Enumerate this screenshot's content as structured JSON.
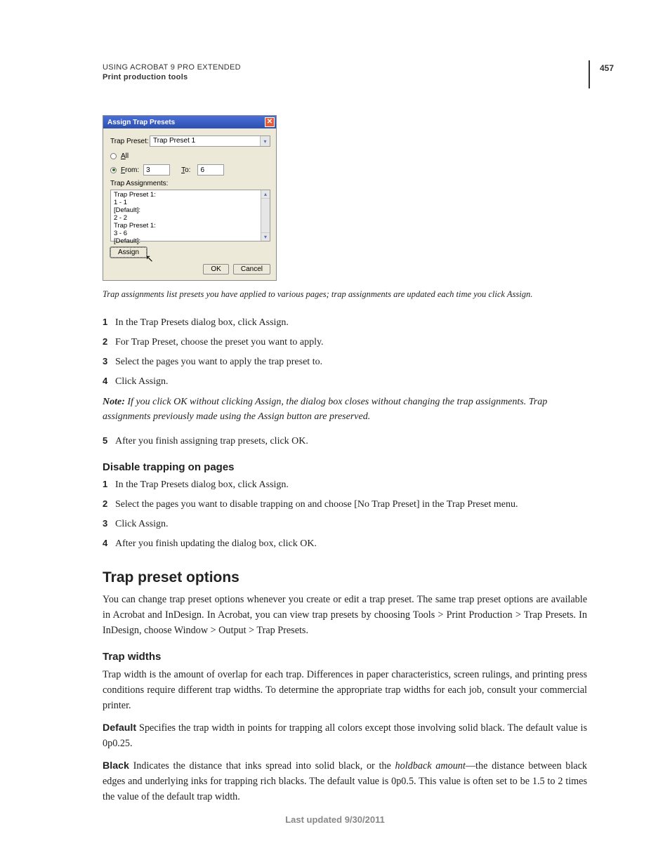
{
  "header": {
    "title": "USING ACROBAT 9 PRO EXTENDED",
    "subtitle": "Print production tools",
    "page_number": "457"
  },
  "dialog": {
    "title": "Assign Trap Presets",
    "trap_preset_label": "Trap Preset:",
    "trap_preset_value": "Trap Preset 1",
    "all_label": "All",
    "from_label": "From:",
    "from_value": "3",
    "to_label": "To:",
    "to_value": "6",
    "assignments_label": "Trap Assignments:",
    "list_items": [
      "Trap Preset 1:",
      "  1 - 1",
      "[Default]:",
      "  2 - 2",
      "Trap Preset 1:",
      "  3 - 6",
      "[Default]:"
    ],
    "assign_button": "Assign",
    "ok_button": "OK",
    "cancel_button": "Cancel"
  },
  "caption": "Trap assignments list presets you have applied to various pages; trap assignments are updated each time you click Assign.",
  "steps_a": [
    "In the Trap Presets dialog box, click Assign.",
    "For Trap Preset, choose the preset you want to apply.",
    "Select the pages you want to apply the trap preset to.",
    "Click Assign."
  ],
  "note": {
    "label": "Note:",
    "text": " If you click OK without clicking Assign, the dialog box closes without changing the trap assignments. Trap assignments previously made using the Assign button are preserved."
  },
  "steps_a5": "After you finish assigning trap presets, click OK.",
  "heading_disable": "Disable trapping on pages",
  "steps_b": [
    "In the Trap Presets dialog box, click Assign.",
    "Select the pages you want to disable trapping on and choose [No Trap Preset] in the Trap Preset menu.",
    "Click Assign.",
    "After you finish updating the dialog box, click OK."
  ],
  "heading_options": "Trap preset options",
  "options_intro": "You can change trap preset options whenever you create or edit a trap preset. The same trap preset options are available in Acrobat and InDesign. In Acrobat, you can view trap presets by choosing Tools > Print Production > Trap Presets. In InDesign, choose Window > Output > Trap Presets.",
  "heading_widths": "Trap widths",
  "widths_intro": "Trap width is the amount of overlap for each trap. Differences in paper characteristics, screen rulings, and printing press conditions require different trap widths. To determine the appropriate trap widths for each job, consult your commercial printer.",
  "default_def": {
    "term": "Default",
    "text": "  Specifies the trap width in points for trapping all colors except those involving solid black. The default value is 0p0.25."
  },
  "black_def": {
    "term": "Black",
    "text_before": "  Indicates the distance that inks spread into solid black, or the ",
    "italic": "holdback amount",
    "text_after": "—the distance between black edges and underlying inks for trapping rich blacks. The default value is 0p0.5. This value is often set to be 1.5 to 2 times the value of the default trap width."
  },
  "footer": "Last updated 9/30/2011"
}
